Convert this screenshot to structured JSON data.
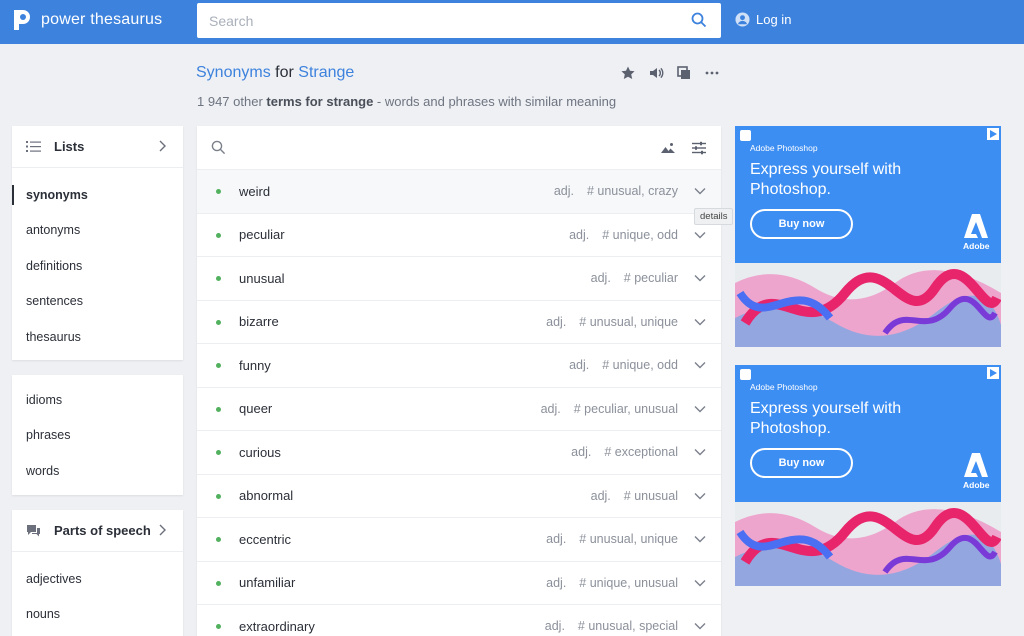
{
  "header": {
    "brand": "power thesaurus",
    "search_placeholder": "Search",
    "login_label": "Log in"
  },
  "title": {
    "part1": "Synonyms",
    "part2": " for ",
    "part3": "Strange",
    "subtitle_prefix": "1 947 other ",
    "subtitle_bold": "terms for strange",
    "subtitle_suffix": " - words and phrases with similar meaning",
    "actions": [
      "star-icon",
      "speaker-icon",
      "copy-icon",
      "more-icon"
    ]
  },
  "sidebar": {
    "lists_title": "Lists",
    "lists": [
      "synonyms",
      "antonyms",
      "definitions",
      "sentences",
      "thesaurus"
    ],
    "active": "synonyms",
    "misc": [
      "idioms",
      "phrases",
      "words"
    ],
    "pos_title": "Parts of speech",
    "pos": [
      "adjectives",
      "nouns"
    ]
  },
  "results": [
    {
      "word": "weird",
      "pos": "adj.",
      "tags": "# unusual, crazy"
    },
    {
      "word": "peculiar",
      "pos": "adj.",
      "tags": "# unique, odd"
    },
    {
      "word": "unusual",
      "pos": "adj.",
      "tags": "# peculiar"
    },
    {
      "word": "bizarre",
      "pos": "adj.",
      "tags": "# unusual, unique"
    },
    {
      "word": "funny",
      "pos": "adj.",
      "tags": "# unique, odd"
    },
    {
      "word": "queer",
      "pos": "adj.",
      "tags": "# peculiar, unusual"
    },
    {
      "word": "curious",
      "pos": "adj.",
      "tags": "# exceptional"
    },
    {
      "word": "abnormal",
      "pos": "adj.",
      "tags": "# unusual"
    },
    {
      "word": "eccentric",
      "pos": "adj.",
      "tags": "# unusual, unique"
    },
    {
      "word": "unfamiliar",
      "pos": "adj.",
      "tags": "# unique, unusual"
    },
    {
      "word": "extraordinary",
      "pos": "adj.",
      "tags": "# unusual, special"
    }
  ],
  "tooltip": "details",
  "ads": [
    {
      "brand": "Adobe Photoshop",
      "headline": "Express yourself with Photoshop.",
      "cta": "Buy now",
      "logo_text": "Adobe"
    },
    {
      "brand": "Adobe Photoshop",
      "headline": "Express yourself with Photoshop.",
      "cta": "Buy now",
      "logo_text": "Adobe"
    }
  ],
  "colors": {
    "accent": "#3d82dd",
    "bullet": "#52b15e",
    "ad_bg": "#3d8ef2"
  }
}
